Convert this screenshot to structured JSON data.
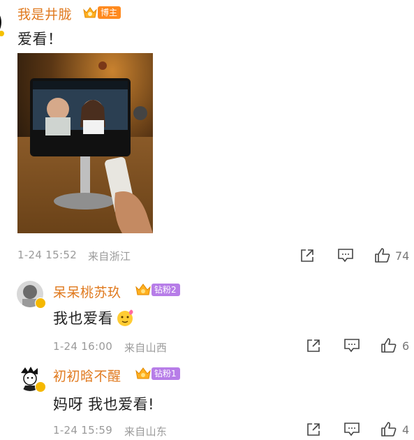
{
  "main_comment": {
    "author": "我是井胧",
    "badge": "博主",
    "text": "爱看！",
    "time": "1-24 15:52",
    "location": "来自浙江",
    "likes": "74"
  },
  "replies": [
    {
      "author": "呆呆桃苏玖",
      "badge": "钻粉2",
      "text": "我也爱看",
      "time": "1-24 16:00",
      "location": "来自山西",
      "likes": "6"
    },
    {
      "author": "初初晗不醒",
      "badge": "钻粉1",
      "text": "妈呀 我也爱看!",
      "time": "1-24 15:59",
      "location": "来自山东",
      "likes": "4"
    }
  ],
  "icons": {
    "share": "share-icon",
    "comment": "comment-icon",
    "like": "thumbs-up-icon",
    "crown": "crown-icon",
    "emoji": "love-emoji-icon"
  },
  "colors": {
    "author_name": "#e07a1f",
    "blogger_badge": "#ff8a1e",
    "fan_badge": "#b77de8",
    "meta_text": "#9a9a9a"
  }
}
